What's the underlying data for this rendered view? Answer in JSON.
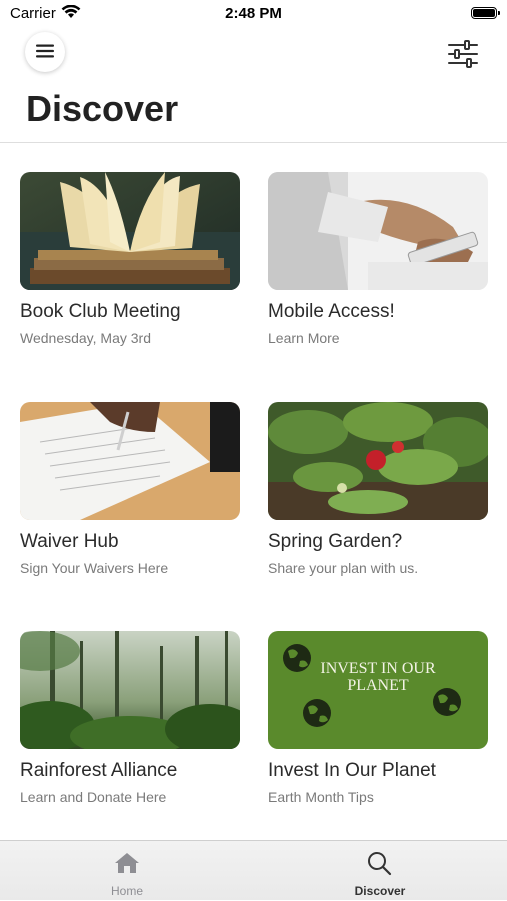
{
  "status_bar": {
    "carrier": "Carrier",
    "time": "2:48 PM"
  },
  "header": {
    "title": "Discover",
    "menu_icon": "hamburger-icon",
    "filter_icon": "sliders-icon"
  },
  "cards": [
    {
      "title": "Book Club Meeting",
      "subtitle": "Wednesday, May 3rd",
      "image": "open-book-photo"
    },
    {
      "title": "Mobile Access!",
      "subtitle": "Learn More",
      "image": "hand-phone-photo"
    },
    {
      "title": "Waiver Hub",
      "subtitle": "Sign Your Waivers Here",
      "image": "signing-document-photo"
    },
    {
      "title": "Spring Garden?",
      "subtitle": "Share your plan with us.",
      "image": "strawberry-plant-photo"
    },
    {
      "title": "Rainforest Alliance",
      "subtitle": "Learn and Donate Here",
      "image": "rainforest-photo"
    },
    {
      "title": "Invest In Our Planet",
      "subtitle": "Earth Month Tips",
      "image": "earth-globes-banner",
      "banner_text": [
        "INVEST IN OUR",
        "PLANET"
      ]
    }
  ],
  "tab_bar": {
    "tabs": [
      {
        "label": "Home",
        "icon": "house-icon",
        "active": false
      },
      {
        "label": "Discover",
        "icon": "search-icon",
        "active": true
      }
    ]
  },
  "colors": {
    "banner_green": "#5a8a2c",
    "active_tab": "#333333",
    "inactive_tab": "#8e8e93"
  }
}
